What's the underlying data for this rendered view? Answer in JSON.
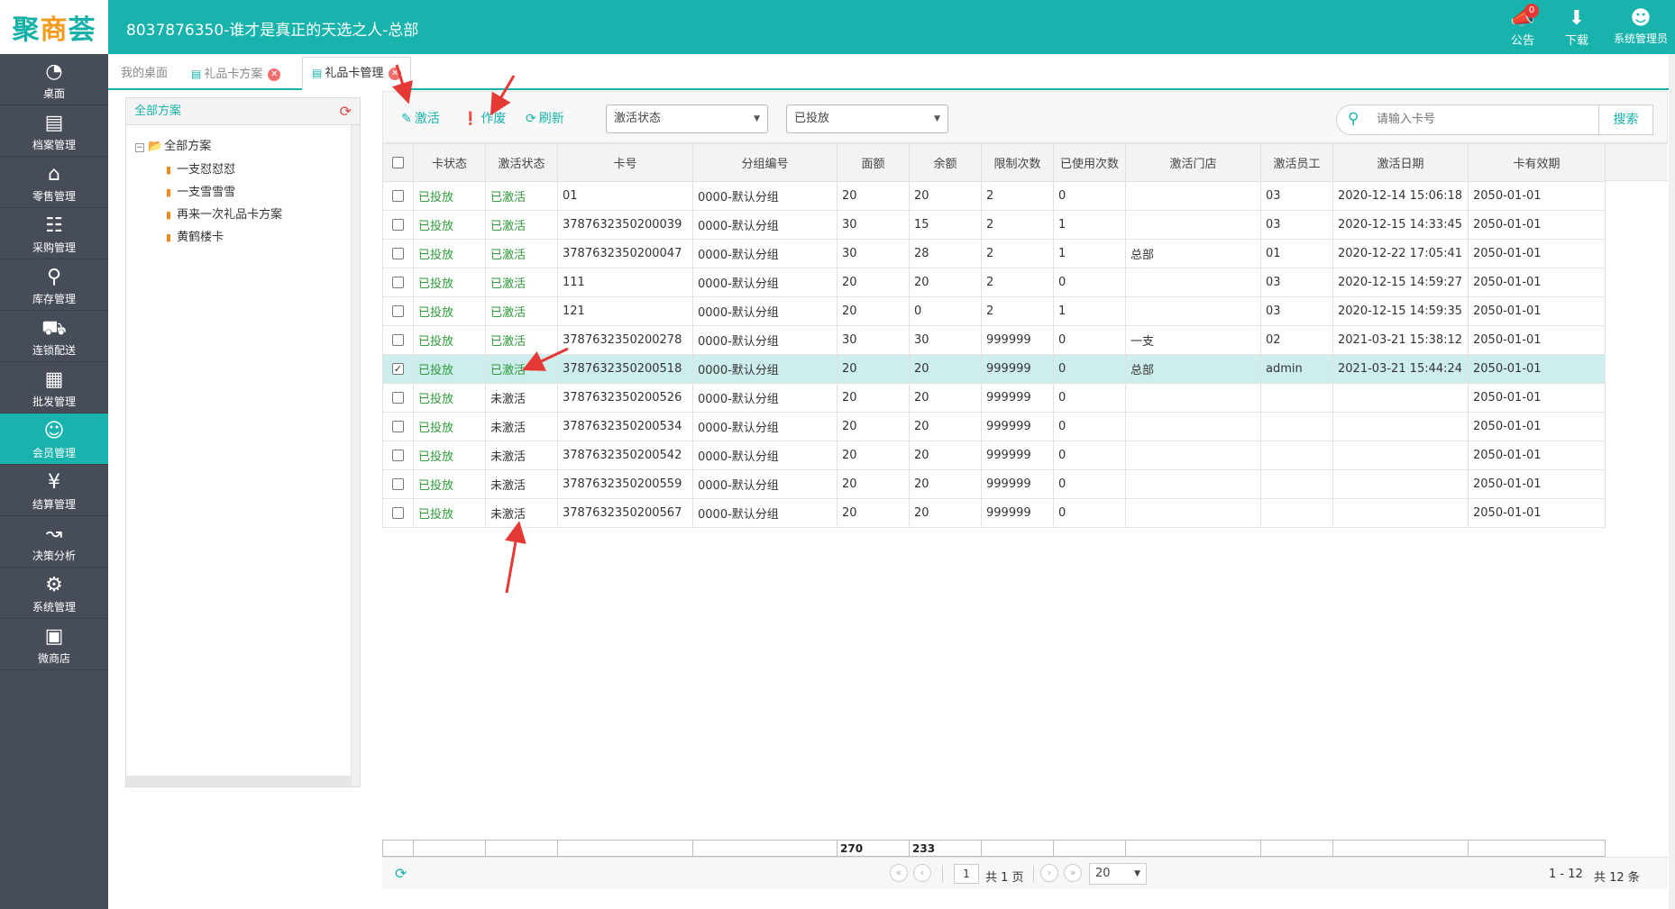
{
  "header": {
    "logo_a": "聚",
    "logo_b": "商",
    "logo_c": "荟",
    "title": "8037876350-谁才是真正的天选之人-总部",
    "announce_label": "公告",
    "announce_badge": "0",
    "download_label": "下载",
    "user_label": "系统管理员"
  },
  "sidebar": {
    "items": [
      {
        "label": "桌面",
        "icon": "dashboard-icon"
      },
      {
        "label": "档案管理",
        "icon": "archive-icon"
      },
      {
        "label": "零售管理",
        "icon": "store-icon"
      },
      {
        "label": "采购管理",
        "icon": "purchase-icon"
      },
      {
        "label": "库存管理",
        "icon": "inventory-icon"
      },
      {
        "label": "连锁配送",
        "icon": "truck-icon"
      },
      {
        "label": "批发管理",
        "icon": "wholesale-icon"
      },
      {
        "label": "会员管理",
        "icon": "member-icon"
      },
      {
        "label": "结算管理",
        "icon": "settlement-icon"
      },
      {
        "label": "决策分析",
        "icon": "chart-icon"
      },
      {
        "label": "系统管理",
        "icon": "gear-icon"
      },
      {
        "label": "微商店",
        "icon": "shop-bag-icon"
      }
    ]
  },
  "tabs": [
    {
      "label": "我的桌面"
    },
    {
      "label": "礼品卡方案"
    },
    {
      "label": "礼品卡管理"
    }
  ],
  "tree": {
    "title": "全部方案",
    "root": "全部方案",
    "children": [
      "一支怼怼怼",
      "一支雪雪雪",
      "再来一次礼品卡方案",
      "黄鹤楼卡"
    ]
  },
  "toolbar": {
    "activate": "激活",
    "void": "作废",
    "refresh": "刷新",
    "status_filter": "激活状态",
    "issue_filter": "已投放",
    "search_placeholder": "请输入卡号",
    "search_button": "搜索"
  },
  "table": {
    "columns": [
      "卡状态",
      "激活状态",
      "卡号",
      "分组编号",
      "面额",
      "余额",
      "限制次数",
      "已使用次数",
      "激活门店",
      "激活员工",
      "激活日期",
      "卡有效期"
    ],
    "rows": [
      {
        "checked": "",
        "status": "已投放",
        "act": "已激活",
        "card": "01",
        "group": "0000-默认分组",
        "face": "20",
        "bal": "20",
        "limit": "2",
        "used": "0",
        "store": "",
        "staff": "03",
        "date": "2020-12-14 15:06:18",
        "expire": "2050-01-01"
      },
      {
        "checked": "",
        "status": "已投放",
        "act": "已激活",
        "card": "3787632350200039",
        "group": "0000-默认分组",
        "face": "30",
        "bal": "15",
        "limit": "2",
        "used": "1",
        "store": "",
        "staff": "03",
        "date": "2020-12-15 14:33:45",
        "expire": "2050-01-01"
      },
      {
        "checked": "",
        "status": "已投放",
        "act": "已激活",
        "card": "3787632350200047",
        "group": "0000-默认分组",
        "face": "30",
        "bal": "28",
        "limit": "2",
        "used": "1",
        "store": "总部",
        "staff": "01",
        "date": "2020-12-22 17:05:41",
        "expire": "2050-01-01"
      },
      {
        "checked": "",
        "status": "已投放",
        "act": "已激活",
        "card": "111",
        "group": "0000-默认分组",
        "face": "20",
        "bal": "20",
        "limit": "2",
        "used": "0",
        "store": "",
        "staff": "03",
        "date": "2020-12-15 14:59:27",
        "expire": "2050-01-01"
      },
      {
        "checked": "",
        "status": "已投放",
        "act": "已激活",
        "card": "121",
        "group": "0000-默认分组",
        "face": "20",
        "bal": "0",
        "limit": "2",
        "used": "1",
        "store": "",
        "staff": "03",
        "date": "2020-12-15 14:59:35",
        "expire": "2050-01-01"
      },
      {
        "checked": "",
        "status": "已投放",
        "act": "已激活",
        "card": "3787632350200278",
        "group": "0000-默认分组",
        "face": "30",
        "bal": "30",
        "limit": "999999",
        "used": "0",
        "store": "一支",
        "staff": "02",
        "date": "2021-03-21 15:38:12",
        "expire": "2050-01-01"
      },
      {
        "checked": "✓",
        "status": "已投放",
        "act": "已激活",
        "card": "3787632350200518",
        "group": "0000-默认分组",
        "face": "20",
        "bal": "20",
        "limit": "999999",
        "used": "0",
        "store": "总部",
        "staff": "admin",
        "date": "2021-03-21 15:44:24",
        "expire": "2050-01-01"
      },
      {
        "checked": "",
        "status": "已投放",
        "act": "未激活",
        "card": "3787632350200526",
        "group": "0000-默认分组",
        "face": "20",
        "bal": "20",
        "limit": "999999",
        "used": "0",
        "store": "",
        "staff": "",
        "date": "",
        "expire": "2050-01-01"
      },
      {
        "checked": "",
        "status": "已投放",
        "act": "未激活",
        "card": "3787632350200534",
        "group": "0000-默认分组",
        "face": "20",
        "bal": "20",
        "limit": "999999",
        "used": "0",
        "store": "",
        "staff": "",
        "date": "",
        "expire": "2050-01-01"
      },
      {
        "checked": "",
        "status": "已投放",
        "act": "未激活",
        "card": "3787632350200542",
        "group": "0000-默认分组",
        "face": "20",
        "bal": "20",
        "limit": "999999",
        "used": "0",
        "store": "",
        "staff": "",
        "date": "",
        "expire": "2050-01-01"
      },
      {
        "checked": "",
        "status": "已投放",
        "act": "未激活",
        "card": "3787632350200559",
        "group": "0000-默认分组",
        "face": "20",
        "bal": "20",
        "limit": "999999",
        "used": "0",
        "store": "",
        "staff": "",
        "date": "",
        "expire": "2050-01-01"
      },
      {
        "checked": "",
        "status": "已投放",
        "act": "未激活",
        "card": "3787632350200567",
        "group": "0000-默认分组",
        "face": "20",
        "bal": "20",
        "limit": "999999",
        "used": "0",
        "store": "",
        "staff": "",
        "date": "",
        "expire": "2050-01-01"
      }
    ],
    "footer": {
      "face_total": "270",
      "bal_total": "233"
    }
  },
  "pager": {
    "page": "1",
    "total_pages": "共 1 页",
    "page_size": "20",
    "range": "1 - 12",
    "total": "共 12 条"
  },
  "colors": {
    "accent": "#17b3ac",
    "sidebar": "#474d58",
    "green_text": "#2e9a3a",
    "selected_row": "#cdeeec",
    "annotation": "#e53935"
  }
}
